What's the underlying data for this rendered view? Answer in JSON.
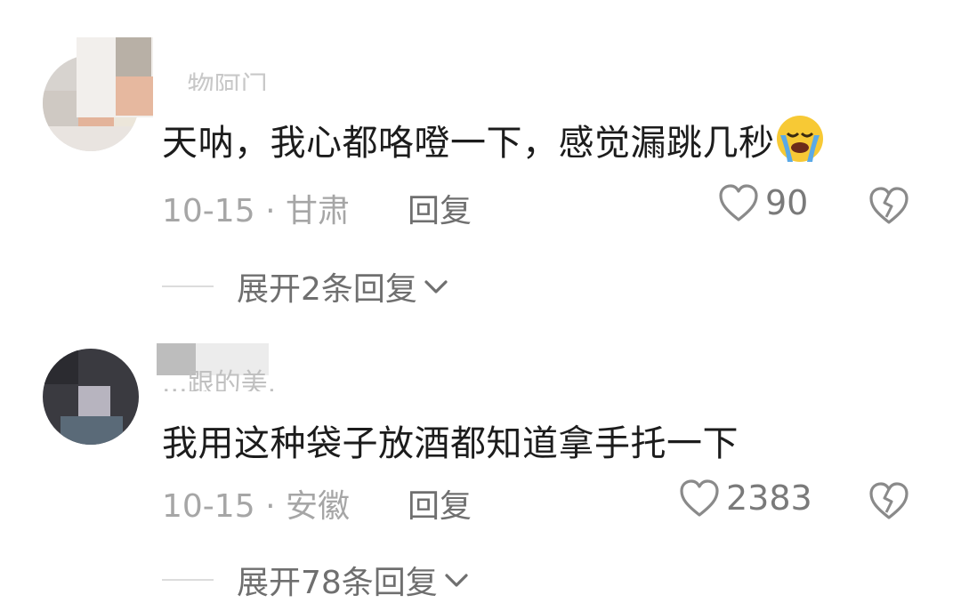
{
  "comments": [
    {
      "username": "...物阿门",
      "text": "天呐，我心都咯噔一下，感觉漏跳几秒",
      "emoji": "loudly-crying-face",
      "date": "10-15",
      "location": "甘肃",
      "reply_label": "回复",
      "likes": "90",
      "expand_label": "展开2条回复"
    },
    {
      "username": "...跟的美.",
      "text": "我用这种袋子放酒都知道拿手托一下",
      "date": "10-15",
      "location": "安徽",
      "reply_label": "回复",
      "likes": "2383",
      "expand_label": "展开78条回复"
    }
  ],
  "separator": "·",
  "colors": {
    "text": "#1c1c1c",
    "meta": "#a6a6a6",
    "action": "#6f6f6f",
    "icon": "#8a8a8a"
  }
}
